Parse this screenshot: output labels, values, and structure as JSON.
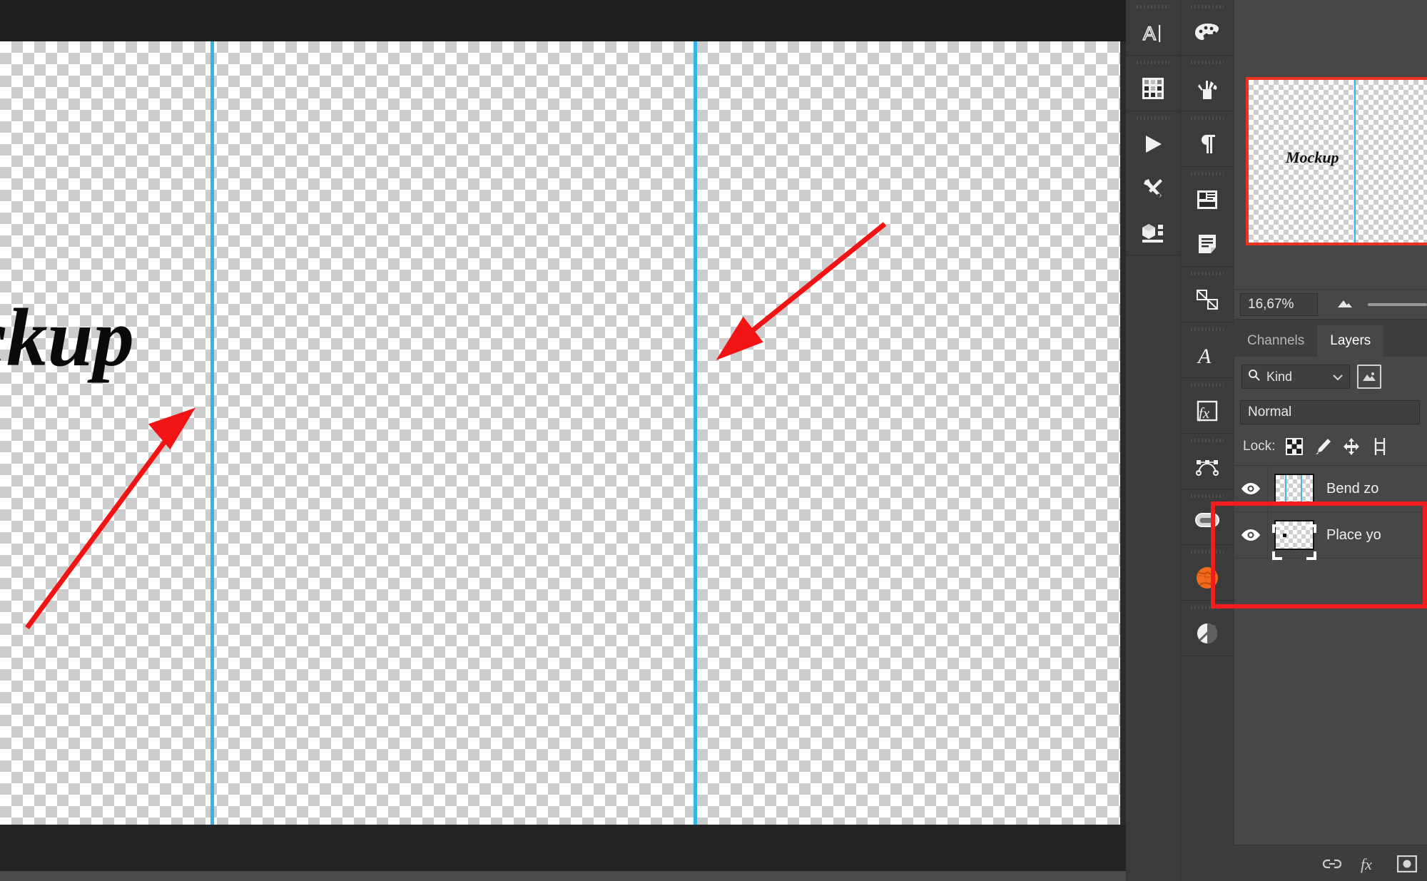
{
  "document": {
    "artwork_text": "ckup",
    "full_artwork_text": "Mockup",
    "guide_color": "#34b5e8",
    "annotation_color": "#f41d1d",
    "transparency_checker": true
  },
  "navigator": {
    "thumbnail_label": "Mockup",
    "zoom_value": "16,67%",
    "border_color": "#ef3124"
  },
  "tool_rail": {
    "left_column": [
      {
        "name": "character-panel-icon",
        "glyph": "A|"
      },
      {
        "name": "kuler-grid-panel-icon",
        "glyph": "grid"
      },
      {
        "name": "timeline-play-panel-icon",
        "glyph": "play"
      },
      {
        "name": "tool-presets-panel-icon",
        "glyph": "tools"
      },
      {
        "name": "3d-panel-icon",
        "glyph": "cube"
      }
    ],
    "right_column": [
      {
        "name": "color-palette-panel-icon",
        "glyph": "palette"
      },
      {
        "name": "brushes-panel-icon",
        "glyph": "brushes"
      },
      {
        "name": "paragraph-panel-icon",
        "glyph": "pilcrow"
      },
      {
        "name": "layer-comps-panel-icon",
        "glyph": "comps"
      },
      {
        "name": "notes-panel-icon",
        "glyph": "note"
      },
      {
        "name": "clone-source-panel-icon",
        "glyph": "clone"
      },
      {
        "name": "glyphs-panel-icon",
        "glyph": "A-serif"
      },
      {
        "name": "styles-panel-icon",
        "glyph": "fx"
      },
      {
        "name": "paths-panel-icon",
        "glyph": "path"
      },
      {
        "name": "creative-cloud-libraries-icon",
        "glyph": "cc"
      },
      {
        "name": "adobe-stock-icon",
        "glyph": "stock"
      },
      {
        "name": "adjustments-panel-icon",
        "glyph": "half-circle"
      }
    ]
  },
  "layers_panel": {
    "tabs": [
      {
        "label": "Channels",
        "active": false
      },
      {
        "label": "Layers",
        "active": true
      }
    ],
    "filter": {
      "kind_label": "Kind",
      "search_icon": "search-icon",
      "chevron_icon": "chevron-down-icon",
      "pixel_filter_icon": "pixel-layer-filter-icon"
    },
    "blend_mode": "Normal",
    "lock": {
      "label": "Lock:",
      "buttons": [
        {
          "name": "lock-transparent-pixels-icon"
        },
        {
          "name": "lock-image-pixels-brush-icon"
        },
        {
          "name": "lock-position-move-icon"
        },
        {
          "name": "lock-artboard-nesting-icon"
        }
      ]
    },
    "rows": [
      {
        "name": "Bend zo",
        "visible": true,
        "selected": false,
        "thumb_type": "guides",
        "visibility_icon": "eye-icon"
      },
      {
        "name": "Place yo",
        "visible": true,
        "selected": false,
        "thumb_type": "smart-object",
        "visibility_icon": "eye-icon"
      }
    ],
    "footer_icons": [
      {
        "name": "link-layers-icon"
      },
      {
        "name": "layer-style-fx-icon"
      },
      {
        "name": "add-layer-mask-icon"
      }
    ]
  },
  "annotations": {
    "arrows": [
      {
        "name": "arrow-to-left-guide",
        "direction": "up-right"
      },
      {
        "name": "arrow-to-right-guide",
        "direction": "down-left"
      }
    ],
    "highlight_box": {
      "name": "layers-highlight-box"
    }
  }
}
